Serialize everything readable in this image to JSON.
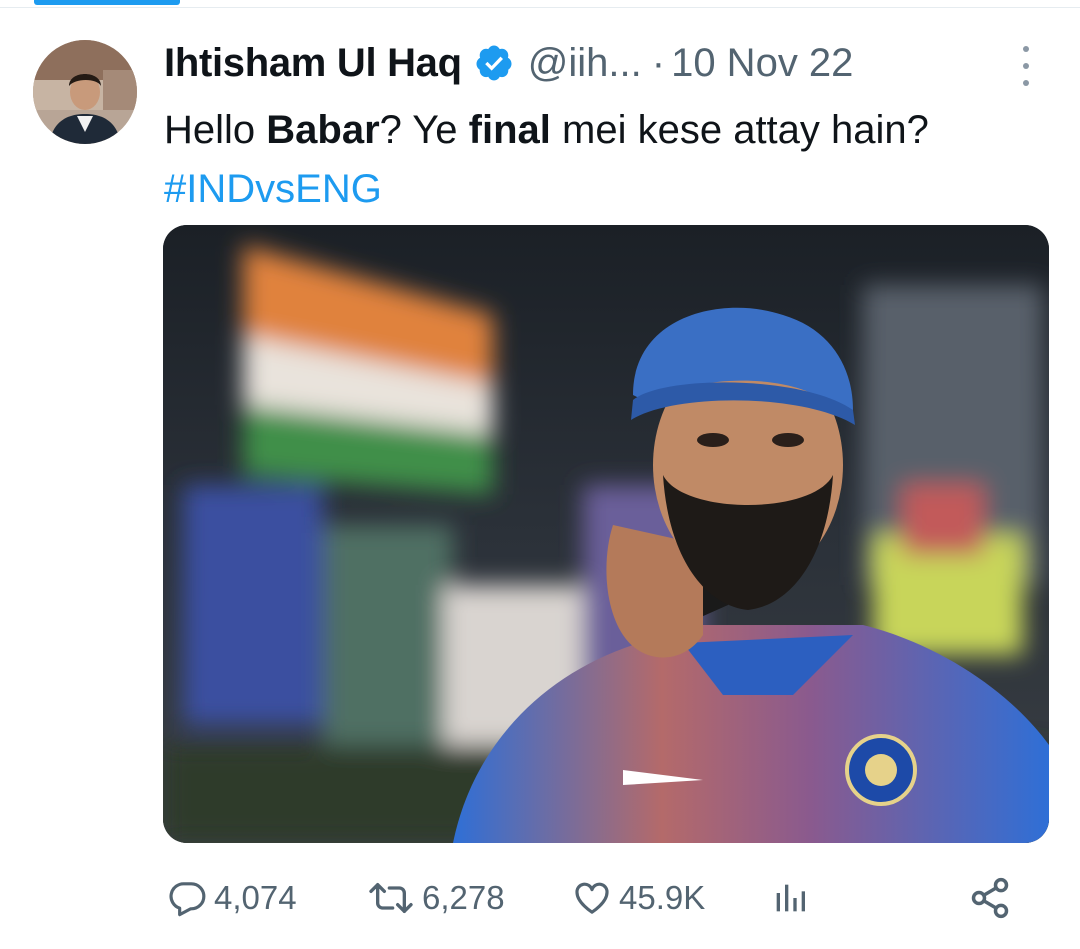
{
  "tweet": {
    "author": {
      "name": "Ihtisham Ul Haq",
      "handle": "@iih...",
      "separator": "·",
      "date": "10 Nov 22"
    },
    "text": {
      "p1": "Hello ",
      "b1": "Babar",
      "p2": "? Ye ",
      "b2": "final",
      "p3": " mei kese attay hain?"
    },
    "hashtag": "#INDvsENG",
    "stats": {
      "replies": "4,074",
      "retweets": "6,278",
      "likes": "45.9K"
    }
  },
  "icons": [
    "verified-badge-icon",
    "more-options-icon",
    "reply-icon",
    "retweet-icon",
    "like-icon",
    "analytics-icon",
    "share-icon"
  ],
  "colors": {
    "accent": "#1d9bf0",
    "text": "#0f1419",
    "secondary": "#536471"
  }
}
